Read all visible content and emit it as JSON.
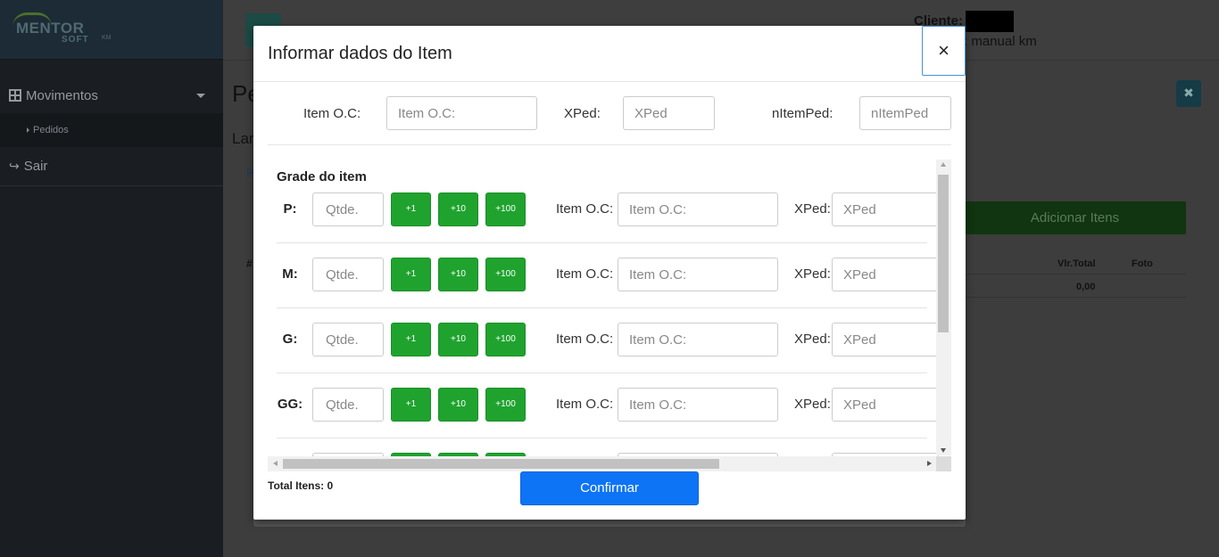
{
  "sidebar": {
    "logo": {
      "main": "MENTOR",
      "sub": "SOFT",
      "tag": "KM"
    },
    "items": [
      {
        "label": "Movimentos"
      },
      {
        "label": "Pedidos"
      },
      {
        "label": "Sair"
      }
    ]
  },
  "header": {
    "cliente_label": "Cliente:",
    "cliente_sub": ": manual km"
  },
  "background": {
    "title": "Pe",
    "subtitle": "Lan",
    "link": "P",
    "hash": "#",
    "add_button": "Adicionar Itens",
    "table": {
      "col_total": "Vlr.Total",
      "col_foto": "Foto",
      "total_value": "0,00"
    }
  },
  "modal": {
    "title": "Informar dados do Item",
    "close": "×",
    "top_fields": {
      "item_oc_label": "Item O.C:",
      "item_oc_placeholder": "Item O.C:",
      "xped_label": "XPed:",
      "xped_placeholder": "XPed",
      "nitemped_label": "nItemPed:",
      "nitemped_placeholder": "nItemPed"
    },
    "grade_title": "Grade do item",
    "rows": [
      {
        "size": "P:",
        "qty_placeholder": "Qtde.",
        "oc_label": "Item O.C:",
        "oc_placeholder": "Item O.C:",
        "xped_label": "XPed:",
        "xped_placeholder": "XPed"
      },
      {
        "size": "M:",
        "qty_placeholder": "Qtde.",
        "oc_label": "Item O.C:",
        "oc_placeholder": "Item O.C:",
        "xped_label": "XPed:",
        "xped_placeholder": "XPed"
      },
      {
        "size": "G:",
        "qty_placeholder": "Qtde.",
        "oc_label": "Item O.C:",
        "oc_placeholder": "Item O.C:",
        "xped_label": "XPed:",
        "xped_placeholder": "XPed"
      },
      {
        "size": "GG:",
        "qty_placeholder": "Qtde.",
        "oc_label": "Item O.C:",
        "oc_placeholder": "Item O.C:",
        "xped_label": "XPed:",
        "xped_placeholder": "XPed"
      }
    ],
    "increments": [
      "+1",
      "+10",
      "+100"
    ],
    "total_itens": "Total Itens: 0",
    "confirm": "Confirmar"
  },
  "colors": {
    "increment_green": "#1fa32e",
    "confirm_blue": "#0d74f5",
    "overlay_dark": "#3d3d3d"
  }
}
